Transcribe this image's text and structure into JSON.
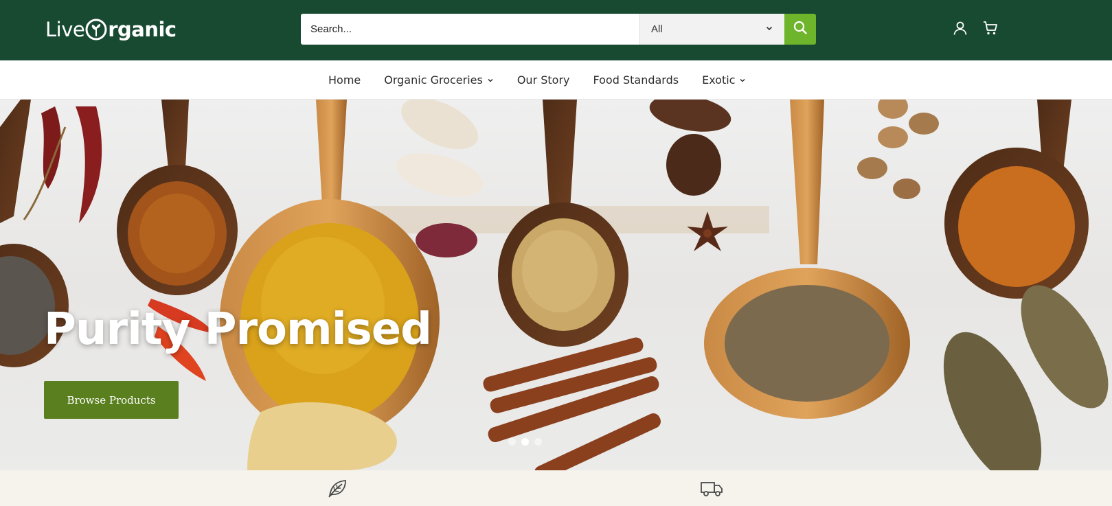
{
  "brand": {
    "logo_part1": "Live",
    "logo_part2": "rganic",
    "colors": {
      "header_bg": "#184a32",
      "accent": "#6fb52c",
      "cta": "#5a7f1f"
    }
  },
  "search": {
    "placeholder": "Search...",
    "category": "All",
    "icon": "search-icon"
  },
  "header_icons": [
    "user-icon",
    "cart-icon"
  ],
  "nav": {
    "items": [
      {
        "label": "Home",
        "has_dropdown": false
      },
      {
        "label": "Organic Groceries",
        "has_dropdown": true
      },
      {
        "label": "Our Story",
        "has_dropdown": false
      },
      {
        "label": "Food Standards",
        "has_dropdown": false
      },
      {
        "label": "Exotic",
        "has_dropdown": true
      }
    ]
  },
  "hero": {
    "title": "Purity Promised",
    "cta_label": "Browse Products",
    "slides": 3,
    "active_slide": 2
  },
  "features": {
    "icons": [
      "leaf-icon",
      "truck-icon"
    ]
  }
}
